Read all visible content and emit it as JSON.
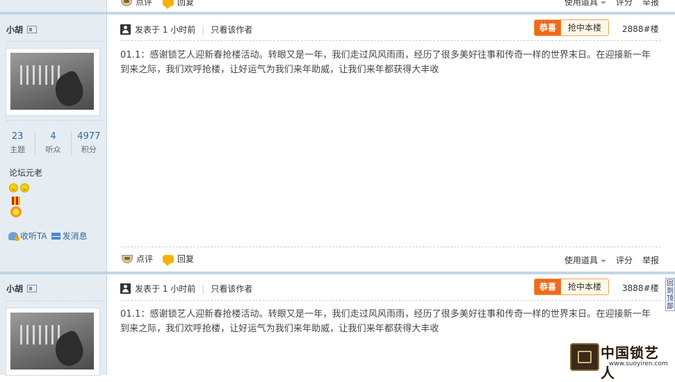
{
  "actions": {
    "comment": "点评",
    "reply": "回复"
  },
  "post_tools": {
    "use_props": "使用道具",
    "rate": "评分",
    "report": "举报"
  },
  "posts": [
    {
      "username": "小胡",
      "stats": [
        {
          "value": "23",
          "label": "主题"
        },
        {
          "value": "4",
          "label": "听众"
        },
        {
          "value": "4977",
          "label": "积分"
        }
      ],
      "group": "论坛元老",
      "follow_label": "收听TA",
      "message_label": "发消息",
      "posted_time": "发表于 1 小时前",
      "only_author": "只看该作者",
      "badge_a": "恭喜",
      "badge_b": "抢中本楼",
      "floor": "2888#楼",
      "content": "01.1：感谢锁艺人迎新春抢楼活动。转眼又是一年，我们走过风风雨雨，经历了很多美好往事和传奇一样的世界末日。在迎接新一年到来之际，我们欢呼抢楼，让好运气为我们来年助威，让我们来年都获得大丰收"
    },
    {
      "username": "小胡",
      "posted_time": "发表于 1 小时前",
      "only_author": "只看该作者",
      "badge_a": "恭喜",
      "badge_b": "抢中本楼",
      "floor": "3888#楼",
      "content": "01.1：感谢锁艺人迎新春抢楼活动。转眼又是一年，我们走过风风雨雨，经历了很多美好往事和传奇一样的世界末日。在迎接新一年到来之际，我们欢呼抢楼，让好运气为我们来年助威，让我们来年都获得大丰收"
    }
  ],
  "back_to_top": "回到顶部",
  "logo": {
    "brand": "中国锁艺人",
    "url": "www.suoyiren.com"
  }
}
